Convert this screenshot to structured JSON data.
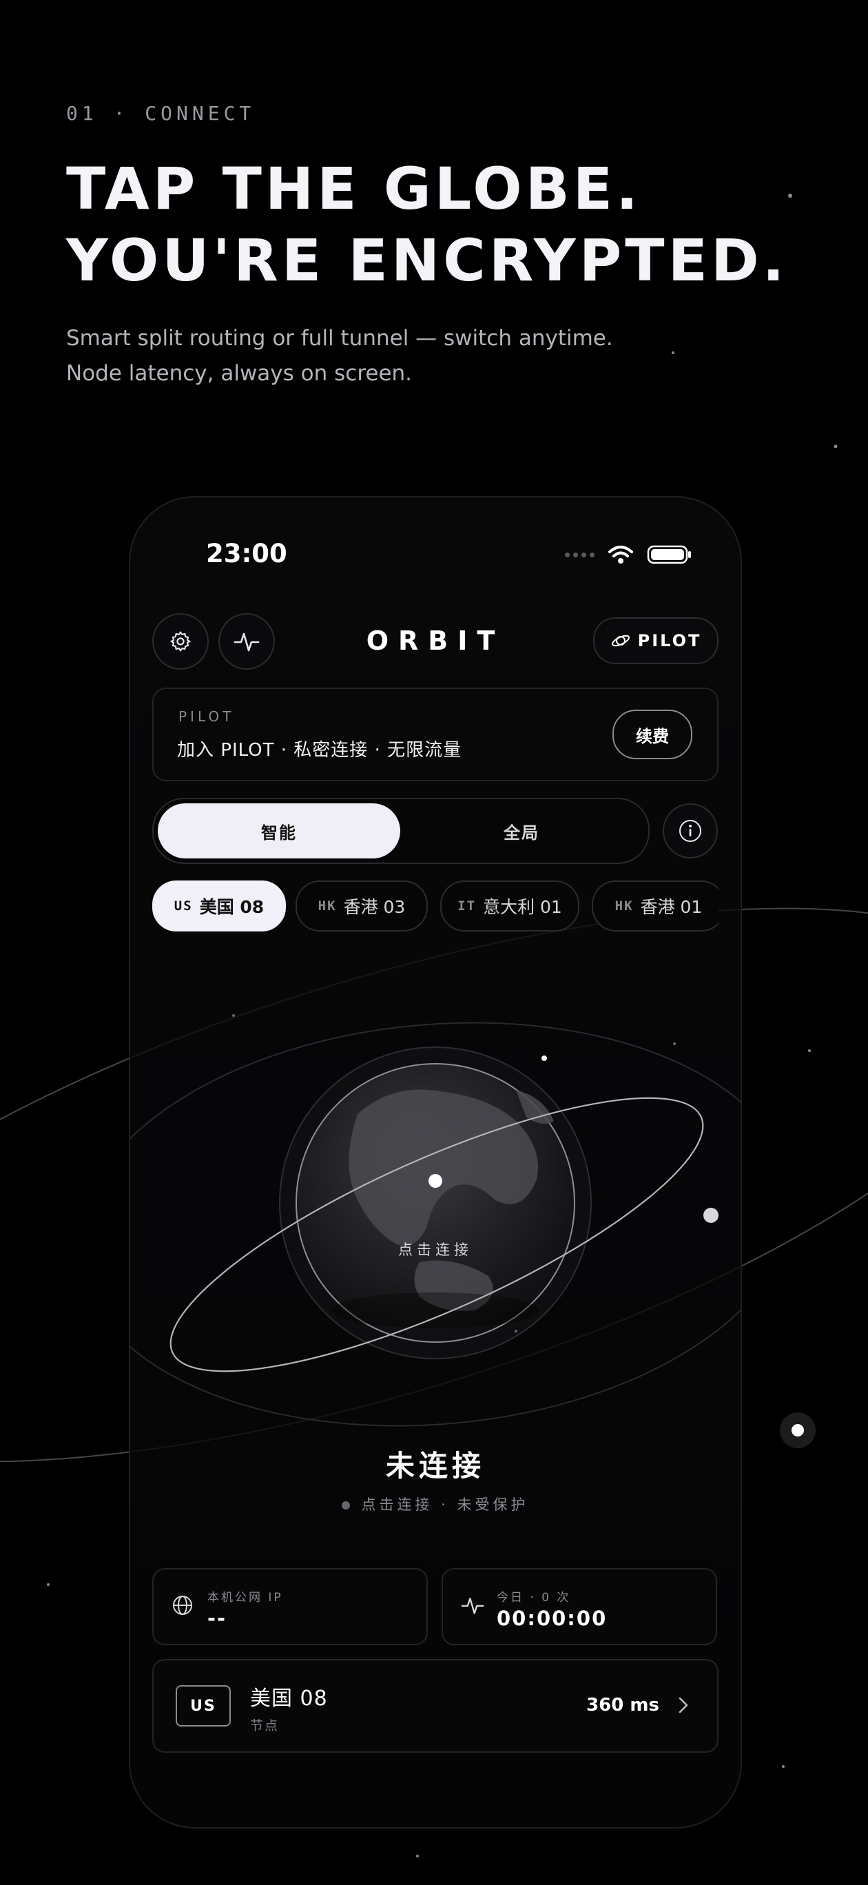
{
  "hero": {
    "eyebrow": "01 · CONNECT",
    "headline_line1": "TAP THE GLOBE.",
    "headline_line2": "YOU'RE ENCRYPTED.",
    "subtitle_line1": "Smart split routing or full tunnel — switch anytime.",
    "subtitle_line2": "Node latency, always on screen."
  },
  "status_bar": {
    "time": "23:00",
    "icons": [
      "signal-dots-icon",
      "wifi-icon",
      "battery-icon"
    ]
  },
  "header": {
    "settings_icon": "gear-icon",
    "activity_icon": "pulse-icon",
    "logo": "ORBIT",
    "pilot_button": "PILOT",
    "pilot_icon": "planet-icon"
  },
  "promo": {
    "kicker": "PILOT",
    "text": "加入 PILOT · 私密连接 · 无限流量",
    "button": "续费"
  },
  "mode": {
    "options": [
      "智能",
      "全局"
    ],
    "selected": "智能",
    "info_icon": "info-icon"
  },
  "nodes": [
    {
      "code": "US",
      "name": "美国 08",
      "active": true
    },
    {
      "code": "HK",
      "name": "香港 03",
      "active": false
    },
    {
      "code": "IT",
      "name": "意大利 01",
      "active": false
    },
    {
      "code": "HK",
      "name": "香港 01",
      "active": false
    }
  ],
  "globe": {
    "label": "点击连接"
  },
  "connection": {
    "title": "未连接",
    "subtitle": "点击连接 · 未受保护"
  },
  "stats": {
    "ip": {
      "label": "本机公网 IP",
      "value": "--",
      "icon": "globe-icon"
    },
    "today": {
      "label": "今日 · 0 次",
      "value": "00:00:00",
      "icon": "pulse-icon"
    }
  },
  "current_node": {
    "code": "US",
    "name": "美国 08",
    "kind": "节点",
    "latency": "360 ms",
    "icon": "chevron-right-icon"
  },
  "colors": {
    "background": "#000000",
    "accent": "#f0eef6",
    "text_primary": "#f4f4f8",
    "text_secondary": "#8a8a92",
    "card_border": "#242428"
  }
}
